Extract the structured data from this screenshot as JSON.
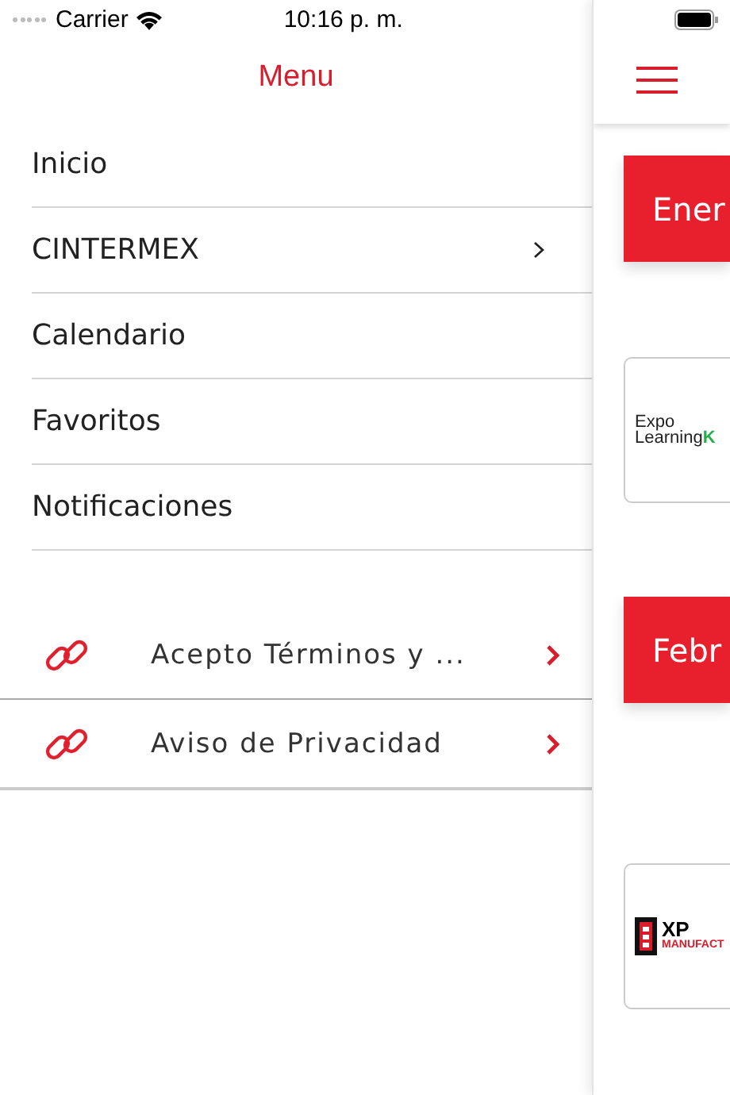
{
  "status_bar": {
    "carrier": "Carrier",
    "time": "10:16 p. m."
  },
  "menu": {
    "title": "Menu",
    "items": [
      {
        "label": "Inicio",
        "has_submenu": false
      },
      {
        "label": "CINTERMEX",
        "has_submenu": true
      },
      {
        "label": "Calendario",
        "has_submenu": false
      },
      {
        "label": "Favoritos",
        "has_submenu": false
      },
      {
        "label": "Notificaciones",
        "has_submenu": false
      }
    ],
    "links": [
      {
        "label": "Acepto Términos y ..."
      },
      {
        "label": "Aviso de Privacidad"
      }
    ]
  },
  "content": {
    "sections": [
      {
        "month": "Ener",
        "kind": "learning",
        "logo_lines": [
          "Expo",
          "Learning",
          "K"
        ]
      },
      {
        "month": "Febr",
        "kind": "manufacturing",
        "logo_lines": [
          "XP",
          "MANUFACT"
        ]
      }
    ]
  }
}
